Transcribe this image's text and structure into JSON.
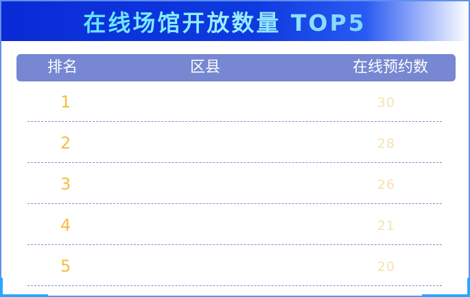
{
  "title": "在线场馆开放数量 TOP5",
  "table": {
    "headers": {
      "rank": "排名",
      "district": "区县",
      "count": "在线预约数"
    },
    "rows": [
      {
        "rank": "1",
        "district": "",
        "count": "30"
      },
      {
        "rank": "2",
        "district": "",
        "count": "28"
      },
      {
        "rank": "3",
        "district": "",
        "count": "26"
      },
      {
        "rank": "4",
        "district": "",
        "count": "21"
      },
      {
        "rank": "5",
        "district": "",
        "count": "20"
      }
    ]
  },
  "colors": {
    "title_bar": "#0f3ae0",
    "header_bg": "#7787d2",
    "rank_text": "#f4be3a",
    "count_text": "#f6e2b2",
    "divider": "#6f93c6"
  }
}
